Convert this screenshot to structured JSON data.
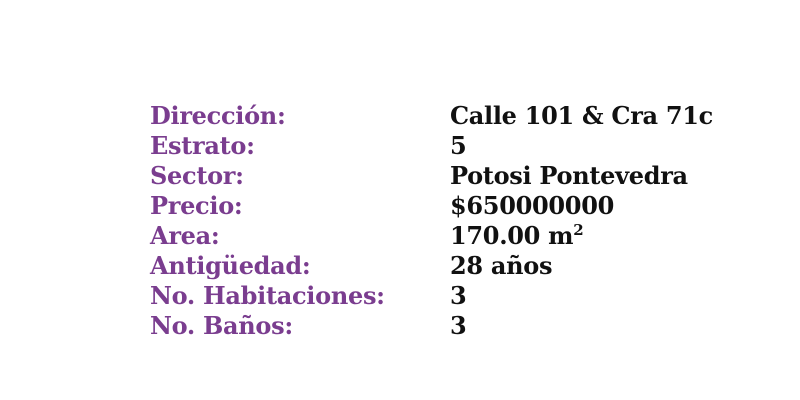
{
  "property": {
    "rows": [
      {
        "label": "Dirección:",
        "value": "Calle 101 & Cra 71c"
      },
      {
        "label": "Estrato:",
        "value": "5"
      },
      {
        "label": "Sector:",
        "value": "Potosi Pontevedra"
      },
      {
        "label": "Precio:",
        "value": "$650000000"
      },
      {
        "label": "Area:",
        "value": "170.00 m",
        "unit_sup": "2"
      },
      {
        "label": "Antigüedad:",
        "value": "28 años"
      },
      {
        "label": "No. Habitaciones:",
        "value": "3"
      },
      {
        "label": "No. Baños:",
        "value": "3"
      }
    ]
  },
  "colors": {
    "label": "#7a3d8f",
    "value": "#111111",
    "background": "#ffffff"
  }
}
